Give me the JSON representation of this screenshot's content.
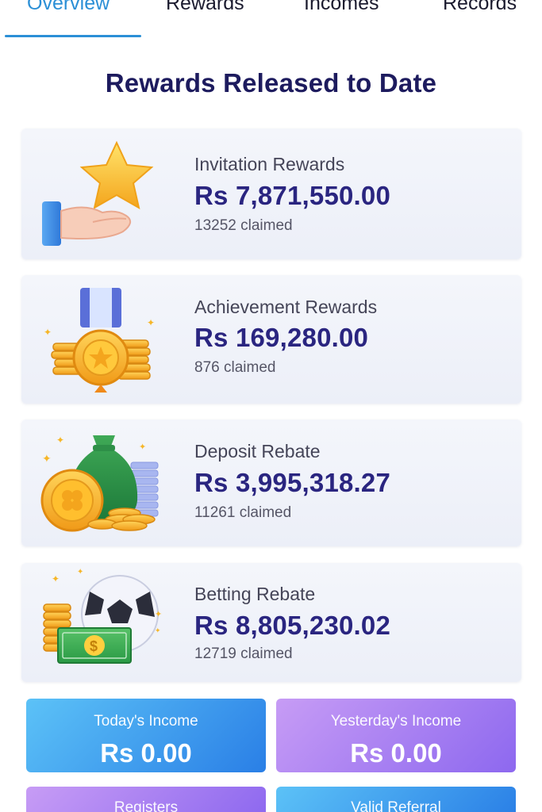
{
  "tabs": [
    {
      "label": "Overview",
      "active": true
    },
    {
      "label": "Rewards",
      "active": false
    },
    {
      "label": "Incomes",
      "active": false
    },
    {
      "label": "Records",
      "active": false
    }
  ],
  "page_title": "Rewards Released to Date",
  "cards": [
    {
      "label": "Invitation Rewards",
      "amount": "Rs 7,871,550.00",
      "claimed": "13252 claimed",
      "icon": "hand-star-icon"
    },
    {
      "label": "Achievement Rewards",
      "amount": "Rs 169,280.00",
      "claimed": "876 claimed",
      "icon": "medal-coins-icon"
    },
    {
      "label": "Deposit Rebate",
      "amount": "Rs 3,995,318.27",
      "claimed": "11261 claimed",
      "icon": "money-bag-coins-icon"
    },
    {
      "label": "Betting Rebate",
      "amount": "Rs 8,805,230.02",
      "claimed": "12719 claimed",
      "icon": "football-cash-icon"
    }
  ],
  "income": {
    "today": {
      "label": "Today's Income",
      "value": "Rs 0.00"
    },
    "yesterday": {
      "label": "Yesterday's Income",
      "value": "Rs 0.00"
    },
    "registers": {
      "label": "Registers"
    },
    "valid_referral": {
      "label": "Valid Referral"
    }
  },
  "colors": {
    "accent": "#2b8fd6",
    "title": "#1d1b5e",
    "amount": "#2a2580",
    "today_gradient": [
      "#5cc2f7",
      "#2a7fe6"
    ],
    "yesterday_gradient": [
      "#c79cf5",
      "#8d68ef"
    ]
  }
}
